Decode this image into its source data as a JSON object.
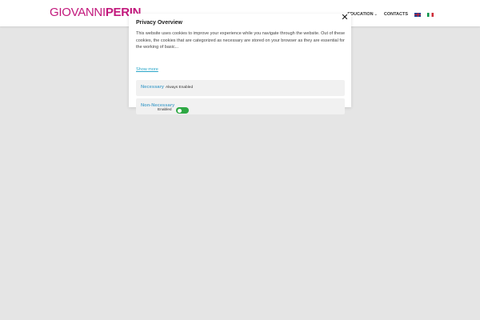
{
  "header": {
    "logo": {
      "first": "GIOVANNI",
      "last": "PERIN"
    },
    "nav": [
      {
        "label": "EDUCATION",
        "has_dropdown": true
      },
      {
        "label": "CONTACTS",
        "has_dropdown": false
      }
    ],
    "flags": [
      "uk-flag-icon",
      "italy-flag-icon"
    ]
  },
  "modal": {
    "title": "Privacy Overview",
    "body": "This website uses cookies to improve your experience while you navigate through the website. Out of these cookies, the cookies that are categorized as necessary are stored on your browser as they are essential for the working of basic...",
    "show_more": "Show more",
    "close_icon": "close-icon",
    "categories": [
      {
        "name": "Necessary",
        "status": "Always Enabled"
      },
      {
        "name": "Non-Necessary",
        "status": "Enabled",
        "toggle_on": true
      }
    ]
  },
  "colors": {
    "brand": "#c2187c",
    "link": "#2aa6c9",
    "category": "#5aa9cf",
    "toggle_on": "#2ea844",
    "backdrop": "#e5e5e5"
  }
}
